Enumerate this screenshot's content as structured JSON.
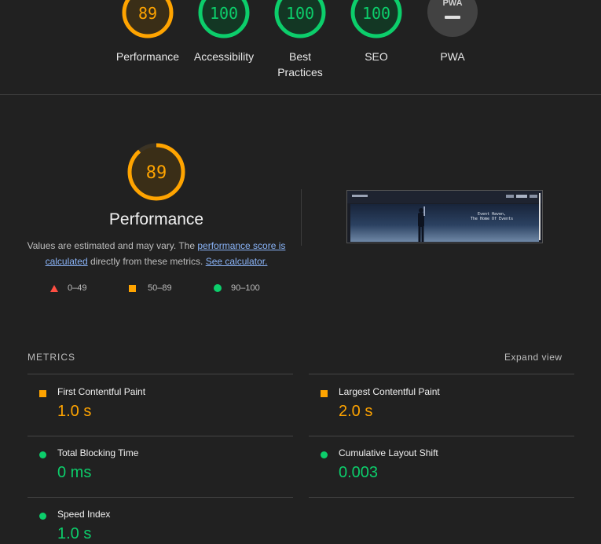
{
  "categories": [
    {
      "label": "Performance",
      "score": "89",
      "color": "#ffa400",
      "fraction": 0.89
    },
    {
      "label": "Accessibility",
      "score": "100",
      "color": "#0cce6b",
      "fraction": 1.0
    },
    {
      "label": "Best Practices",
      "score": "100",
      "color": "#0cce6b",
      "fraction": 1.0
    },
    {
      "label": "SEO",
      "score": "100",
      "color": "#0cce6b",
      "fraction": 1.0
    },
    {
      "label": "PWA",
      "score": "PWA",
      "color": "#9e9e9e"
    }
  ],
  "summary": {
    "score": "89",
    "fraction": 0.89,
    "title": "Performance",
    "desc_prefix": "Values are estimated and may vary. The ",
    "link_score": "performance score is calculated",
    "desc_middle": " directly from these metrics. ",
    "link_calc": "See calculator.",
    "legend": [
      {
        "range": "0–49",
        "shape": "triangle",
        "color": "#ff4e42"
      },
      {
        "range": "50–89",
        "shape": "square",
        "color": "#ffa400"
      },
      {
        "range": "90–100",
        "shape": "circle",
        "color": "#0cce6b"
      }
    ]
  },
  "thumbnail": {
    "hero_line1": "Event Haven,",
    "hero_line2": "The Home Of Events"
  },
  "metrics": {
    "heading": "METRICS",
    "expand_label": "Expand view",
    "items": [
      {
        "name": "First Contentful Paint",
        "value": "1.0 s",
        "status": "average"
      },
      {
        "name": "Largest Contentful Paint",
        "value": "2.0 s",
        "status": "average"
      },
      {
        "name": "Total Blocking Time",
        "value": "0 ms",
        "status": "pass"
      },
      {
        "name": "Cumulative Layout Shift",
        "value": "0.003",
        "status": "pass"
      },
      {
        "name": "Speed Index",
        "value": "1.0 s",
        "status": "pass"
      }
    ]
  }
}
